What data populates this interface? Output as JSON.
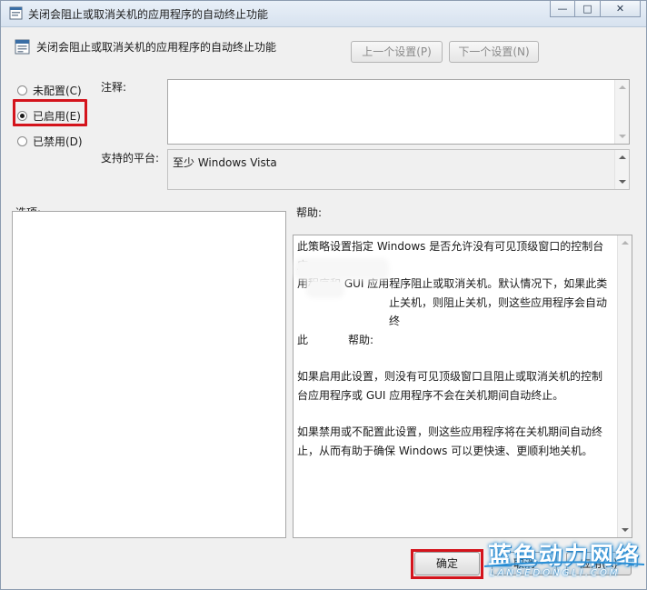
{
  "window": {
    "title": "关闭会阻止或取消关机的应用程序的自动终止功能",
    "minimize_label": "—",
    "maximize_label": "□",
    "close_label": "✕"
  },
  "header": {
    "title": "关闭会阻止或取消关机的应用程序的自动终止功能",
    "prev_button": "上一个设置(P)",
    "next_button": "下一个设置(N)"
  },
  "options": {
    "not_configured": "未配置(C)",
    "enabled": "已启用(E)",
    "disabled": "已禁用(D)",
    "selected": "enabled"
  },
  "comment": {
    "label": "注释:",
    "value": ""
  },
  "platform": {
    "label": "支持的平台:",
    "value": "至少 Windows Vista"
  },
  "sections": {
    "options_label": "选项:",
    "help_label": "帮助:"
  },
  "help": {
    "lines": [
      "此策略设置指定 Windows 是否允许没有可见顶级窗口的控制台应",
      "用程序和 GUI 应用程序阻止或取消关机。默认情况下，如果此类",
      "止关机，则阻止关机，则这些应用程序会自动终",
      "此",
      "帮助:"
    ],
    "paragraph2": "如果启用此设置，则没有可见顶级窗口且阻止或取消关机的控制台应用程序或 GUI 应用程序不会在关机期间自动终止。",
    "paragraph3": "如果禁用或不配置此设置，则这些应用程序将在关机期间自动终止，从而有助于确保 Windows 可以更快速、更顺利地关机。"
  },
  "footer": {
    "ok": "确定",
    "cancel": "取消",
    "apply": "应用(A)"
  },
  "watermark": {
    "cn": "蓝色动力网络",
    "en": "LANSEDONGLI.COM"
  },
  "colors": {
    "highlight": "#d4141c",
    "watermark": "#2a8fd6"
  }
}
